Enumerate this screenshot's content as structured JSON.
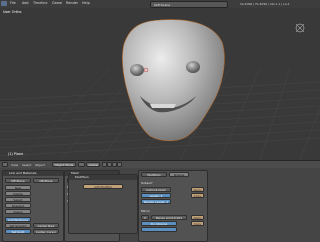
{
  "menubar": {
    "items": [
      "File",
      "Add",
      "Timeline",
      "Game",
      "Render",
      "Help"
    ],
    "scene": "SCE:Scene",
    "stats": "Ve:4096 | Fa:4096 | Ob:1-1 | La:1"
  },
  "viewport": {
    "view_label": "User Ortho",
    "object_label": "(1) Plane"
  },
  "view_header": {
    "view": "View",
    "select": "Select",
    "object": "Object",
    "mode": "Object Mode",
    "global": "Global"
  },
  "properties": {
    "link_panel": {
      "link_label": "Link and Materials",
      "me_field": "ME:Plane",
      "ob_field": "OB:Plane",
      "new_btn": "New",
      "delete_btn": "Delete",
      "select_btn": "Select",
      "deselect_btn": "Deselect",
      "assign_btn": "Assign",
      "autotexspace": "AutoTexSpace",
      "set_smooth": "Set Smooth",
      "set_solid": "Set Solid",
      "center_new": "Center New",
      "center_cursor": "Center Cursor"
    },
    "mesh_panel": {
      "title": "Mesh",
      "autosmooth": "Auto Smooth",
      "degr": "Degr: 30",
      "sticky": "Sticky",
      "uv_texture": "UV Texture",
      "vertex_color": "Vertex Color",
      "make": "Make",
      "new": "New"
    },
    "modifiers_panel": {
      "title": "Modifiers",
      "add_modifier": "Add Modifier"
    },
    "shapes_panel": {
      "title": "Shapes",
      "tab_modifiers": "Modifiers",
      "tab_shapes": "Shapes",
      "apply": "Apply",
      "copy": "Copy",
      "subsurf": "Subsurf",
      "levels": "Levels: 2",
      "render_levels": "Render Levels: 2",
      "catmull": "Catmull-Clark",
      "mirror": "Mirror",
      "axis_x": "X",
      "merge_limit": "Merge Limit:0.001",
      "do_clipping": "Do Clipping"
    }
  },
  "colors": {
    "background": "#393939",
    "mesh_light": "#dcdcdc",
    "mesh_dark": "#6a6a6a",
    "selection": "#5b8fbf",
    "highlight": "#e08a2c"
  }
}
